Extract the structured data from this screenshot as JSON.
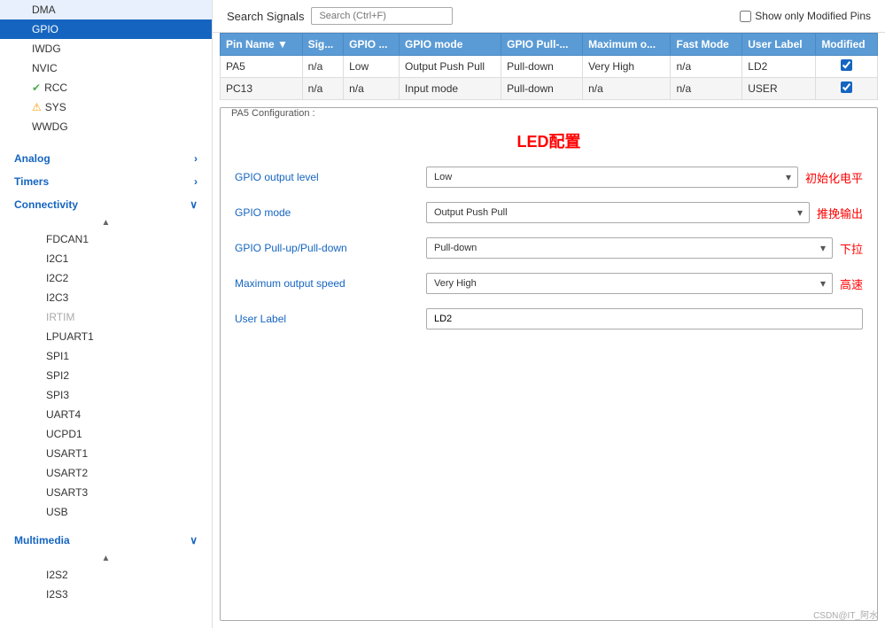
{
  "sidebar": {
    "items_top": [
      {
        "label": "DMA",
        "active": false,
        "indent": 1,
        "prefix": ""
      },
      {
        "label": "GPIO",
        "active": true,
        "indent": 1,
        "prefix": ""
      },
      {
        "label": "IWDG",
        "active": false,
        "indent": 1,
        "prefix": ""
      },
      {
        "label": "NVIC",
        "active": false,
        "indent": 1,
        "prefix": ""
      },
      {
        "label": "RCC",
        "active": false,
        "indent": 1,
        "prefix": "check"
      },
      {
        "label": "SYS",
        "active": false,
        "indent": 1,
        "prefix": "warn"
      },
      {
        "label": "WWDG",
        "active": false,
        "indent": 1,
        "prefix": ""
      }
    ],
    "sections": [
      {
        "label": "Analog",
        "expanded": false,
        "items": []
      },
      {
        "label": "Timers",
        "expanded": false,
        "items": []
      },
      {
        "label": "Connectivity",
        "expanded": true,
        "items": [
          "FDCAN1",
          "I2C1",
          "I2C2",
          "I2C3",
          "IRTIM",
          "LPUART1",
          "SPI1",
          "SPI2",
          "SPI3",
          "UART4",
          "UCPD1",
          "USART1",
          "USART2",
          "USART3",
          "USB"
        ]
      },
      {
        "label": "Multimedia",
        "expanded": true,
        "items": [
          "I2S2",
          "I2S3"
        ]
      }
    ]
  },
  "topbar": {
    "title": "Search Signals",
    "search_placeholder": "Search (Ctrl+F)",
    "show_modified_label": "Show only Modified Pins"
  },
  "table": {
    "columns": [
      "Pin Name",
      "Sig...",
      "GPIO ...",
      "GPIO mode",
      "GPIO Pull-...",
      "Maximum o...",
      "Fast Mode",
      "User Label",
      "Modified"
    ],
    "rows": [
      {
        "pin_name": "PA5",
        "sig": "n/a",
        "gpio_out": "Low",
        "gpio_mode": "Output Push Pull",
        "gpio_pull": "Pull-down",
        "max_speed": "Very High",
        "fast_mode": "n/a",
        "user_label": "LD2",
        "modified": true
      },
      {
        "pin_name": "PC13",
        "sig": "n/a",
        "gpio_out": "n/a",
        "gpio_mode": "Input mode",
        "gpio_pull": "Pull-down",
        "max_speed": "n/a",
        "fast_mode": "n/a",
        "user_label": "USER",
        "modified": true
      }
    ]
  },
  "config": {
    "section_label": "PA5 Configuration :",
    "title": "LED配置",
    "fields": [
      {
        "label": "GPIO output level",
        "value": "Low",
        "annotation": "初始化电平",
        "type": "select"
      },
      {
        "label": "GPIO mode",
        "value": "Output Push Pull",
        "annotation": "推挽输出",
        "type": "select"
      },
      {
        "label": "GPIO Pull-up/Pull-down",
        "value": "Pull-down",
        "annotation": "下拉",
        "type": "select"
      },
      {
        "label": "Maximum output speed",
        "value": "Very High",
        "annotation": "高速",
        "type": "select"
      },
      {
        "label": "User Label",
        "value": "LD2",
        "annotation": "",
        "type": "input"
      }
    ]
  },
  "watermark": "CSDN@IT_阿水"
}
